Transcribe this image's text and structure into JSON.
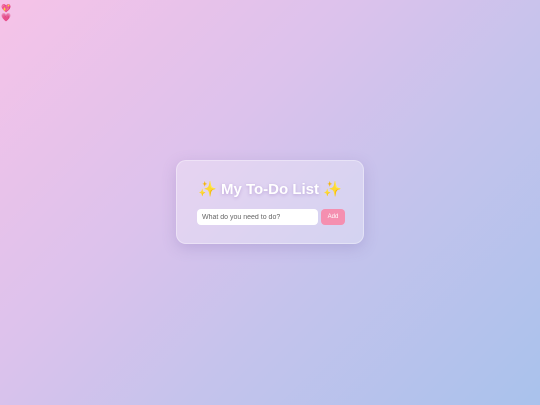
{
  "decor": {
    "hearts": [
      "💖",
      "💗"
    ]
  },
  "card": {
    "title": "My To-Do List",
    "sparkle_left": "✨",
    "sparkle_right": "✨",
    "input": {
      "placeholder": "What do you need to do?",
      "value": ""
    },
    "add_label": "Add"
  },
  "colors": {
    "accent": "#f58fb0",
    "gradient_start": "#f6c3e8",
    "gradient_end": "#a9c2ec"
  }
}
